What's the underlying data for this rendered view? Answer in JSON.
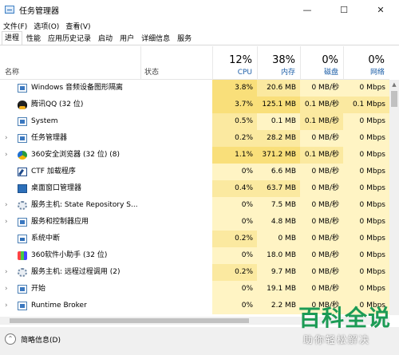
{
  "window": {
    "title": "任务管理器",
    "minimize": "—",
    "maximize": "☐",
    "close": "✕"
  },
  "menu": [
    "文件(F)",
    "选项(O)",
    "查看(V)"
  ],
  "tabs": [
    {
      "label": "进程",
      "active": true
    },
    {
      "label": "性能",
      "active": false
    },
    {
      "label": "应用历史记录",
      "active": false
    },
    {
      "label": "启动",
      "active": false
    },
    {
      "label": "用户",
      "active": false
    },
    {
      "label": "详细信息",
      "active": false
    },
    {
      "label": "服务",
      "active": false
    }
  ],
  "header": {
    "name": "名称",
    "status": "状态",
    "cpu": {
      "pct": "12%",
      "label": "CPU"
    },
    "mem": {
      "pct": "38%",
      "label": "内存"
    },
    "disk": {
      "pct": "0%",
      "label": "磁盘"
    },
    "net": {
      "pct": "0%",
      "label": "网络"
    }
  },
  "processes": [
    {
      "expand": "",
      "icon": "window",
      "name": "Windows 音频设备图形隔离",
      "status": "",
      "cpu": "3.8%",
      "mem": "20.6 MB",
      "disk": "0 MB/秒",
      "net": "0 Mbps"
    },
    {
      "expand": "",
      "icon": "qq",
      "name": "腾讯QQ (32 位)",
      "status": "",
      "cpu": "3.7%",
      "mem": "125.1 MB",
      "disk": "0.1 MB/秒",
      "net": "0.1 Mbps"
    },
    {
      "expand": "",
      "icon": "window",
      "name": "System",
      "status": "",
      "cpu": "0.5%",
      "mem": "0.1 MB",
      "disk": "0.1 MB/秒",
      "net": "0 Mbps"
    },
    {
      "expand": "›",
      "icon": "task",
      "name": "任务管理器",
      "status": "",
      "cpu": "0.2%",
      "mem": "28.2 MB",
      "disk": "0 MB/秒",
      "net": "0 Mbps"
    },
    {
      "expand": "›",
      "icon": "browser",
      "name": "360安全浏览器 (32 位) (8)",
      "status": "",
      "cpu": "1.1%",
      "mem": "371.2 MB",
      "disk": "0.1 MB/秒",
      "net": "0 Mbps"
    },
    {
      "expand": "",
      "icon": "pen",
      "name": "CTF 加载程序",
      "status": "",
      "cpu": "0%",
      "mem": "6.6 MB",
      "disk": "0 MB/秒",
      "net": "0 Mbps"
    },
    {
      "expand": "",
      "icon": "desk",
      "name": "桌面窗口管理器",
      "status": "",
      "cpu": "0.4%",
      "mem": "63.7 MB",
      "disk": "0 MB/秒",
      "net": "0 Mbps"
    },
    {
      "expand": "›",
      "icon": "gear",
      "name": "服务主机: State Repository S...",
      "status": "",
      "cpu": "0%",
      "mem": "7.5 MB",
      "disk": "0 MB/秒",
      "net": "0 Mbps"
    },
    {
      "expand": "›",
      "icon": "window",
      "name": "服务和控制器应用",
      "status": "",
      "cpu": "0%",
      "mem": "4.8 MB",
      "disk": "0 MB/秒",
      "net": "0 Mbps"
    },
    {
      "expand": "",
      "icon": "sys",
      "name": "系统中断",
      "status": "",
      "cpu": "0.2%",
      "mem": "0 MB",
      "disk": "0 MB/秒",
      "net": "0 Mbps"
    },
    {
      "expand": "",
      "icon": "s360",
      "name": "360软件小助手 (32 位)",
      "status": "",
      "cpu": "0%",
      "mem": "18.0 MB",
      "disk": "0 MB/秒",
      "net": "0 Mbps"
    },
    {
      "expand": "›",
      "icon": "gear",
      "name": "服务主机: 远程过程调用 (2)",
      "status": "",
      "cpu": "0.2%",
      "mem": "9.7 MB",
      "disk": "0 MB/秒",
      "net": "0 Mbps"
    },
    {
      "expand": "›",
      "icon": "window",
      "name": "开始",
      "status": "",
      "cpu": "0%",
      "mem": "19.1 MB",
      "disk": "0 MB/秒",
      "net": "0 Mbps"
    },
    {
      "expand": "›",
      "icon": "window",
      "name": "Runtime Broker",
      "status": "",
      "cpu": "0%",
      "mem": "2.2 MB",
      "disk": "0 MB/秒",
      "net": "0 Mbps"
    }
  ],
  "footer": {
    "toggle": "⌃",
    "label": "简略信息(D)"
  },
  "watermark": {
    "title": "百科全说",
    "subtitle": "助你轻松解决"
  },
  "colors": {
    "heat_light": "#fff4c4",
    "heat_mid": "#fbe9a0",
    "heat_high": "#f9df7a",
    "header_blue": "#1d5fa8"
  }
}
